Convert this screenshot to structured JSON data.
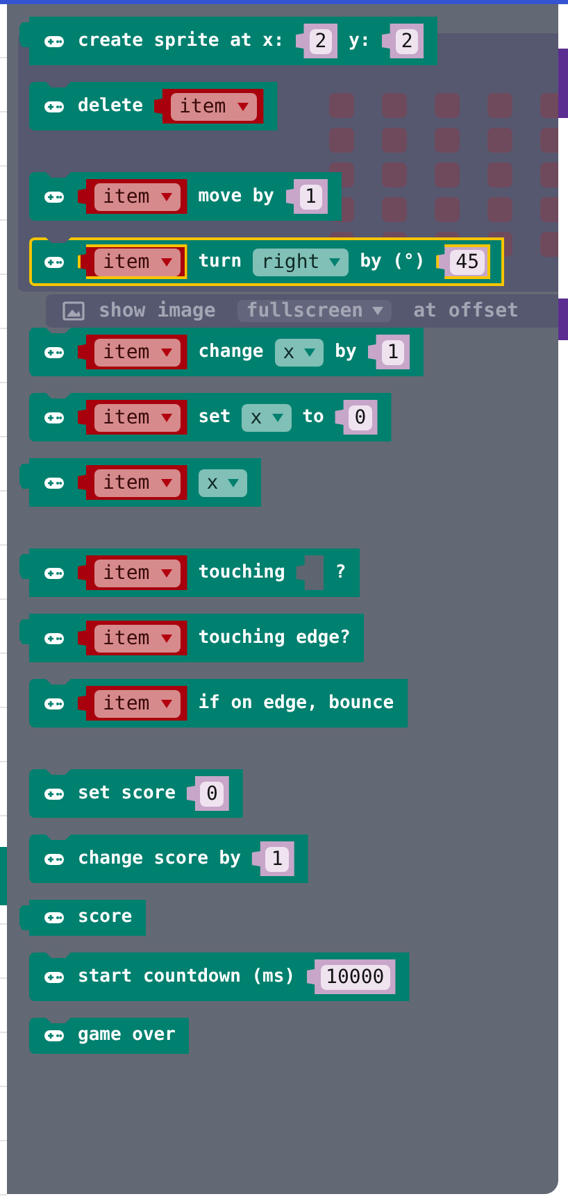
{
  "workspace_blocks": [
    {
      "kind": "image_grid"
    },
    {
      "kind": "row",
      "parts": [
        {
          "kind": "image_label",
          "text": "show image"
        },
        {
          "kind": "dropdown",
          "text": "fullscreen"
        },
        {
          "kind": "label",
          "text": "at offset"
        }
      ]
    }
  ],
  "flyout": {
    "groups": [
      [
        {
          "kind": "reporter",
          "selected": false,
          "parts": [
            {
              "kind": "label",
              "text": "create sprite at x:"
            },
            {
              "kind": "number",
              "text": "2"
            },
            {
              "kind": "label",
              "text": "y:"
            },
            {
              "kind": "number",
              "text": "2"
            }
          ]
        },
        {
          "kind": "statement",
          "selected": false,
          "parts": [
            {
              "kind": "label",
              "text": "delete"
            },
            {
              "kind": "variable",
              "text": "item"
            }
          ]
        }
      ],
      [
        {
          "kind": "statement",
          "selected": false,
          "parts": [
            {
              "kind": "variable",
              "text": "item"
            },
            {
              "kind": "label",
              "text": "move by"
            },
            {
              "kind": "number",
              "text": "1"
            }
          ]
        },
        {
          "kind": "statement",
          "selected": true,
          "parts": [
            {
              "kind": "variable",
              "text": "item"
            },
            {
              "kind": "label",
              "text": "turn"
            },
            {
              "kind": "dropdown",
              "text": "right"
            },
            {
              "kind": "label",
              "text": "by (°)"
            },
            {
              "kind": "number",
              "text": "45"
            }
          ]
        }
      ],
      [
        {
          "kind": "statement",
          "selected": false,
          "parts": [
            {
              "kind": "variable",
              "text": "item"
            },
            {
              "kind": "label",
              "text": "change"
            },
            {
              "kind": "dropdown",
              "text": "x"
            },
            {
              "kind": "label",
              "text": "by"
            },
            {
              "kind": "number",
              "text": "1"
            }
          ]
        },
        {
          "kind": "statement",
          "selected": false,
          "parts": [
            {
              "kind": "variable",
              "text": "item"
            },
            {
              "kind": "label",
              "text": "set"
            },
            {
              "kind": "dropdown",
              "text": "x"
            },
            {
              "kind": "label",
              "text": "to"
            },
            {
              "kind": "number",
              "text": "0"
            }
          ]
        },
        {
          "kind": "reporter",
          "selected": false,
          "parts": [
            {
              "kind": "variable",
              "text": "item"
            },
            {
              "kind": "dropdown",
              "text": "x"
            }
          ]
        }
      ],
      [
        {
          "kind": "reporter",
          "selected": false,
          "parts": [
            {
              "kind": "variable",
              "text": "item"
            },
            {
              "kind": "label",
              "text": "touching"
            },
            {
              "kind": "empty"
            },
            {
              "kind": "label",
              "text": "?"
            }
          ]
        },
        {
          "kind": "reporter",
          "selected": false,
          "parts": [
            {
              "kind": "variable",
              "text": "item"
            },
            {
              "kind": "label",
              "text": "touching edge?"
            }
          ]
        },
        {
          "kind": "statement",
          "selected": false,
          "parts": [
            {
              "kind": "variable",
              "text": "item"
            },
            {
              "kind": "label",
              "text": "if on edge, bounce"
            }
          ]
        }
      ],
      [
        {
          "kind": "statement",
          "selected": false,
          "parts": [
            {
              "kind": "label",
              "text": "set score"
            },
            {
              "kind": "number",
              "text": "0"
            }
          ]
        },
        {
          "kind": "statement",
          "selected": false,
          "parts": [
            {
              "kind": "label",
              "text": "change score by"
            },
            {
              "kind": "number",
              "text": "1"
            }
          ]
        },
        {
          "kind": "reporter",
          "selected": false,
          "parts": [
            {
              "kind": "label",
              "text": "score"
            }
          ]
        },
        {
          "kind": "statement",
          "selected": false,
          "parts": [
            {
              "kind": "label",
              "text": "start countdown (ms)"
            },
            {
              "kind": "number",
              "text": "10000"
            }
          ]
        },
        {
          "kind": "statement",
          "selected": false,
          "parts": [
            {
              "kind": "label",
              "text": "game over"
            }
          ]
        }
      ]
    ]
  }
}
